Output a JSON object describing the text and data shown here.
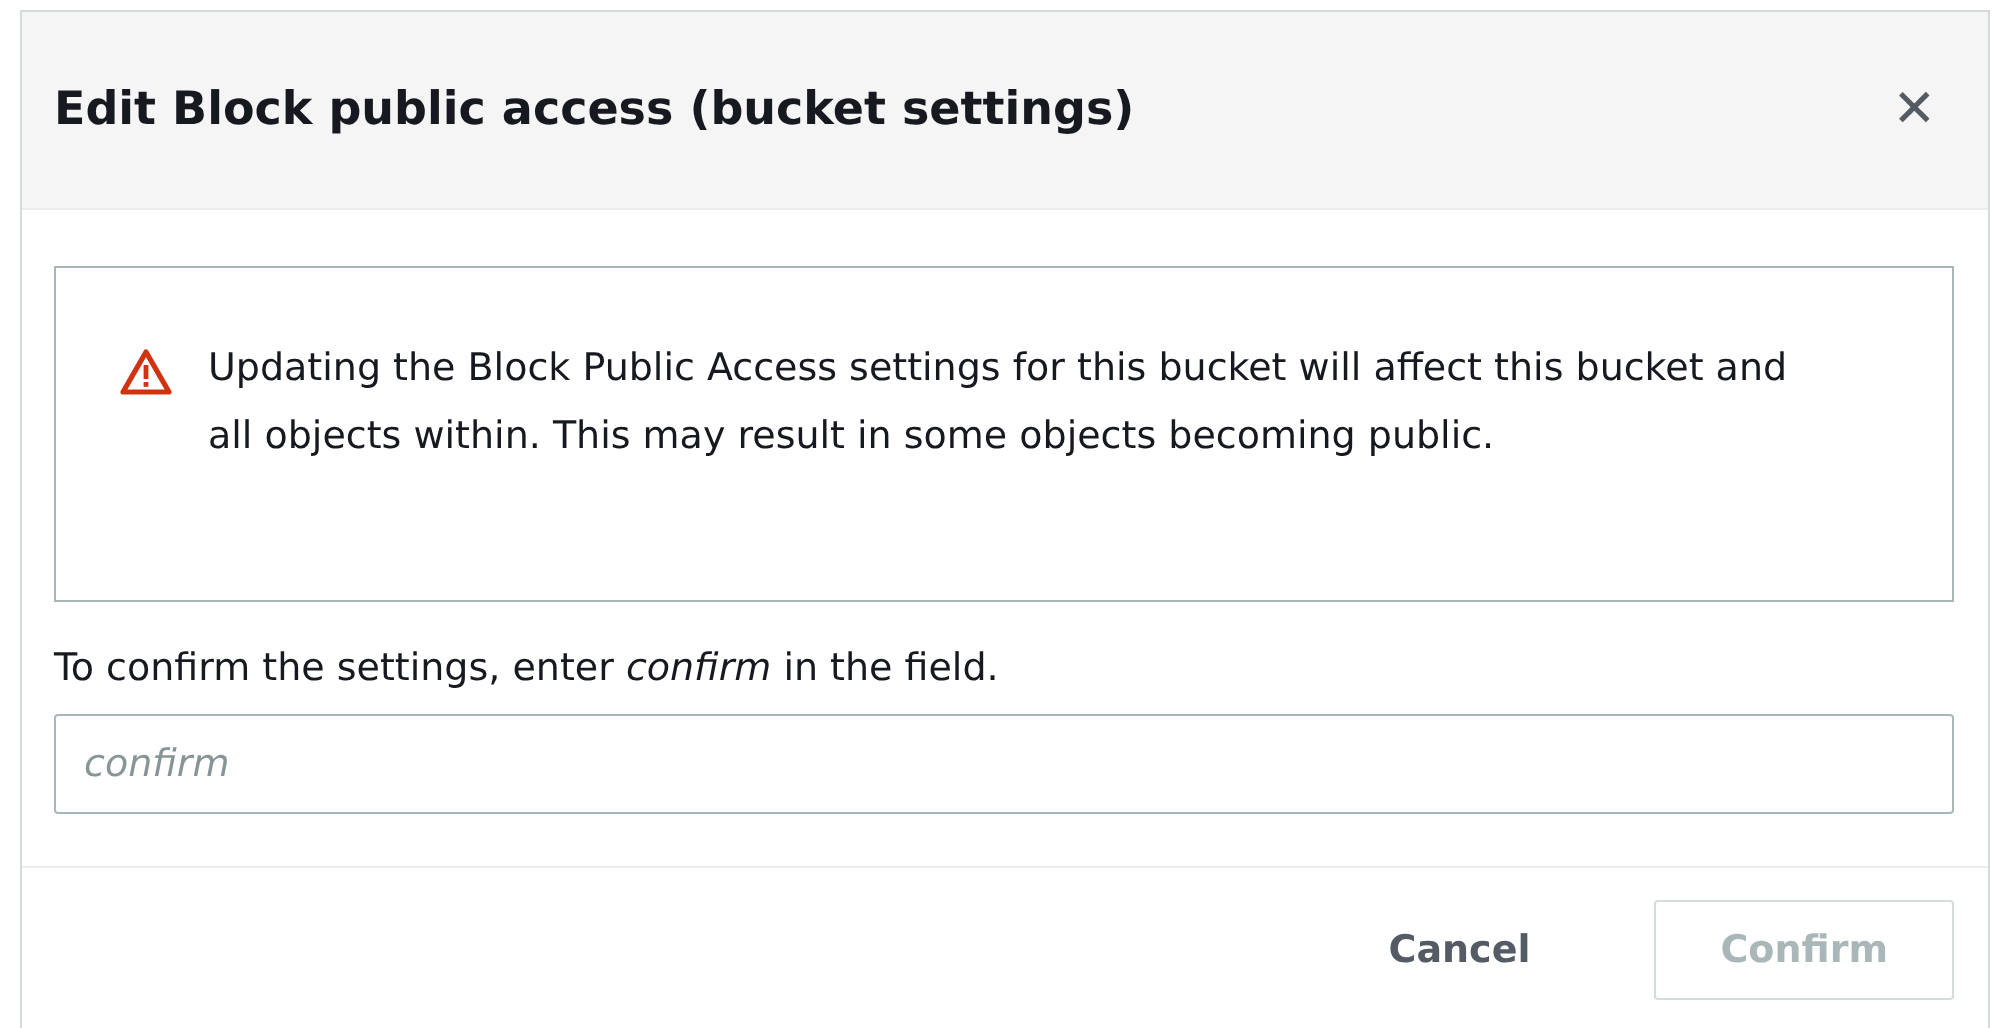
{
  "dialog": {
    "title": "Edit Block public access (bucket settings)",
    "close_icon": "✕"
  },
  "alert": {
    "kind": "warning",
    "message": "Updating the Block Public Access settings for this bucket will affect this bucket and all objects within. This may result in some objects becoming public."
  },
  "prompt": "To confirm the settings, enter *confirm* in the field.",
  "field": {
    "placeholder": "confirm"
  },
  "buttons": [
    {
      "label": "Cancel",
      "kind": "link",
      "disabled": false
    },
    {
      "label": "Confirm",
      "kind": "primary",
      "disabled": true
    }
  ]
}
